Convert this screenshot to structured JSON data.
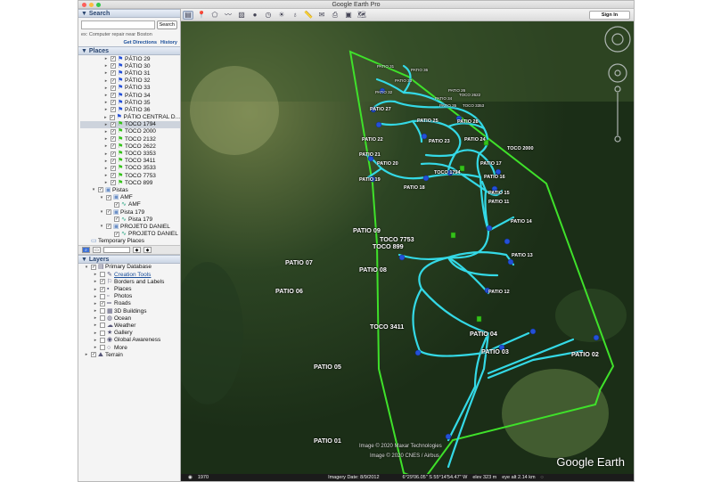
{
  "window": {
    "title": "Google Earth Pro",
    "signin_label": "Sign In"
  },
  "toolbar": {
    "icons": [
      "sidebar-toggle-icon",
      "placemark-icon",
      "polygon-icon",
      "path-icon",
      "image-overlay-icon",
      "record-tour-icon",
      "historical-imagery-icon",
      "sun-icon",
      "planets-icon",
      "ruler-icon",
      "email-icon",
      "print-icon",
      "save-image-icon",
      "view-in-maps-icon"
    ]
  },
  "search": {
    "header": "Search",
    "placeholder": "",
    "button": "Search",
    "hint": "ex: Computer repair near Boston",
    "get_directions": "Get Directions",
    "history": "History"
  },
  "places": {
    "header": "Places",
    "items": [
      {
        "label": "PÁTIO 29",
        "kind": "blue"
      },
      {
        "label": "PÁTIO 30",
        "kind": "blue"
      },
      {
        "label": "PÁTIO 31",
        "kind": "blue"
      },
      {
        "label": "PÁTIO 32",
        "kind": "blue"
      },
      {
        "label": "PÁTIO 33",
        "kind": "blue"
      },
      {
        "label": "PÁTIO 34",
        "kind": "blue"
      },
      {
        "label": "PÁTIO 35",
        "kind": "blue"
      },
      {
        "label": "PÁTIO 36",
        "kind": "blue"
      },
      {
        "label": "PÁTIO CENTRAL D...",
        "kind": "blue"
      },
      {
        "label": "TOCO 1794",
        "kind": "green",
        "selected": true
      },
      {
        "label": "TOCO 2000",
        "kind": "green"
      },
      {
        "label": "TOCO 2132",
        "kind": "green"
      },
      {
        "label": "TOCO 2622",
        "kind": "green"
      },
      {
        "label": "TOCO 3353",
        "kind": "green"
      },
      {
        "label": "TOCO 3411",
        "kind": "green"
      },
      {
        "label": "TOCO 3533",
        "kind": "green"
      },
      {
        "label": "TOCO 7753",
        "kind": "green"
      },
      {
        "label": "TOCO 899",
        "kind": "green"
      }
    ],
    "folders": [
      {
        "label": "Pistas",
        "level": 0
      },
      {
        "label": "AMF",
        "level": 1
      },
      {
        "label": "AMF",
        "level": 2
      },
      {
        "label": "Pista 179",
        "level": 1
      },
      {
        "label": "Pista 179",
        "level": 2
      },
      {
        "label": "PROJETO DANIEL",
        "level": 1
      },
      {
        "label": "PROJETO DANIEL",
        "level": 2
      }
    ],
    "temporary": "Temporary Places"
  },
  "layers": {
    "header": "Layers",
    "items": [
      {
        "label": "Primary Database",
        "level": 0
      },
      {
        "label": "Creation Tools",
        "level": 1,
        "link": true
      },
      {
        "label": "Borders and Labels",
        "level": 1
      },
      {
        "label": "Places",
        "level": 1
      },
      {
        "label": "Photos",
        "level": 1
      },
      {
        "label": "Roads",
        "level": 1
      },
      {
        "label": "3D Buildings",
        "level": 1
      },
      {
        "label": "Ocean",
        "level": 1
      },
      {
        "label": "Weather",
        "level": 1
      },
      {
        "label": "Gallery",
        "level": 1
      },
      {
        "label": "Global Awareness",
        "level": 1
      },
      {
        "label": "More",
        "level": 1
      },
      {
        "label": "Terrain",
        "level": 0
      }
    ]
  },
  "map": {
    "labels_big": [
      "PATIO 09",
      "TOCO 7753",
      "TOCO 899",
      "PATIO 14",
      "PATIO 13",
      "PATIO 12",
      "PATIO 11",
      "PATIO 15",
      "PATIO 07",
      "PATIO 08",
      "PATIO 06",
      "TOCO 3411",
      "PATIO 04",
      "PATIO 03",
      "PATIO 02",
      "PATIO 05",
      "PATIO 01"
    ],
    "labels_mid": [
      "TOCO 1794",
      "TOCO 2000",
      "PATIO 16",
      "PATIO 17",
      "PATIO 18",
      "PATIO 19",
      "PATIO 20",
      "PATIO 21",
      "PATIO 22",
      "PATIO 23",
      "PATIO 24",
      "PATIO 25",
      "PATIO 27",
      "PATIO 28"
    ],
    "labels_small": [
      "PATIO 31",
      "PATIO 36",
      "PATIO 32",
      "PATIO 33",
      "PATIO 34",
      "PATIO 35",
      "PATIO 26",
      "TOCO 3353",
      "TOCO 2622"
    ],
    "copyright_1": "Image © 2020 Maxar Technologies",
    "copyright_2": "Image © 2020 CNES / Airbus",
    "logo": "Google Earth"
  },
  "status": {
    "year": "1970",
    "imagery_date": "Imagery Date: 8/9/2012",
    "coords": "6°29'06.05\" S   55°14'54.47\" W",
    "elev": "elev  323 m",
    "eye_alt": "eye alt  2.14 km"
  },
  "colors": {
    "road": "#34d9e6",
    "boundary": "#3fe12a",
    "pin_blue": "#2450d8",
    "pin_green": "#35c21a"
  }
}
